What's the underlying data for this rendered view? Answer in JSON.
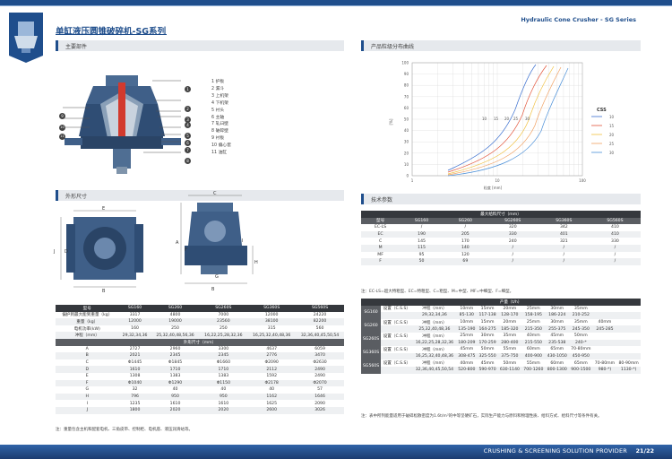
{
  "header": {
    "title_cn": "单缸液压圆锥破碎机-SG系列",
    "title_en": "Hydraulic Cone Crusher - SG Series"
  },
  "sections": {
    "main_parts": "主要部件",
    "size_dist": "产品粒级分布曲线",
    "dimensions": "外形尺寸",
    "tech": "技术参数"
  },
  "parts": [
    "1  护板",
    "2  漏斗",
    "3  上机架",
    "4  下机架",
    "5  衬头",
    "6  主轴",
    "7  轧臼壁",
    "8  破碎壁",
    "9  衬板",
    "10  偏心套",
    "11  油缸"
  ],
  "callouts": [
    "1",
    "2",
    "3",
    "4",
    "5",
    "6",
    "7",
    "8",
    "9",
    "10",
    "11"
  ],
  "dims_labels": {
    "B": "B",
    "E": "E",
    "C": "C",
    "D": "D",
    "J": "J",
    "A": "A",
    "F": "F",
    "I": "I",
    "G": "G",
    "H": "H",
    "Bb": "B"
  },
  "chart_data": {
    "type": "line",
    "xlabel": "粒度 [mm]",
    "ylabel": "[%]",
    "x_ticks": [
      "1",
      "10",
      "100"
    ],
    "y_ticks": [
      "100",
      "90",
      "80",
      "70",
      "60",
      "50",
      "40",
      "30",
      "20",
      "10",
      "0"
    ],
    "legend_title": "CSS",
    "series": [
      {
        "name": "10",
        "color": "#3a6fcf"
      },
      {
        "name": "15",
        "color": "#e2543a"
      },
      {
        "name": "20",
        "color": "#f0c040"
      },
      {
        "name": "25",
        "color": "#f0a060"
      },
      {
        "name": "30",
        "color": "#4a8fd8"
      }
    ],
    "labels": [
      "10",
      "15",
      "20",
      "25",
      "30"
    ]
  },
  "left_table": {
    "header": [
      "型号",
      "SG160",
      "SG260",
      "SG260S",
      "SG360S",
      "SG560S"
    ],
    "rows": [
      [
        "偏护到最大能到重量（kg）",
        "3317",
        "4800",
        "7000",
        "12000",
        "24220"
      ],
      [
        "重量（kg）",
        "12000",
        "19000",
        "23560",
        "38100",
        "82200"
      ],
      [
        "电机功率(kW)",
        "160",
        "250",
        "250",
        "315",
        "560"
      ],
      [
        "冲程（mm）",
        "29,32,34,36",
        "25,32,40,48,56,36",
        "16,22,25,28,32,36",
        "16,25,32,40,48,36",
        "32,36,40,45,50,54"
      ]
    ],
    "sub": "外形尺寸（mm）",
    "dims": [
      [
        "A",
        "2727",
        "2960",
        "3300",
        "4637",
        "6059"
      ],
      [
        "B",
        "2021",
        "2345",
        "2345",
        "2776",
        "3470"
      ],
      [
        "C",
        "Φ1445",
        "Φ1845",
        "Φ1660",
        "Φ2090",
        "Φ2630"
      ],
      [
        "D",
        "1610",
        "1710",
        "1710",
        "2112",
        "2490"
      ],
      [
        "E",
        "1308",
        "1383",
        "1383",
        "1592",
        "2490"
      ],
      [
        "F",
        "Φ1040",
        "Φ1290",
        "Φ1150",
        "Φ2178",
        "Φ2070"
      ],
      [
        "G",
        "32",
        "40",
        "40",
        "40",
        "57"
      ],
      [
        "H",
        "796",
        "950",
        "950",
        "1162",
        "1646"
      ],
      [
        "I",
        "1235",
        "1610",
        "1610",
        "1625",
        "2090"
      ],
      [
        "J",
        "1800",
        "2020",
        "2020",
        "2600",
        "3026"
      ]
    ],
    "note": "注：重量包含主机和配套电机、三角皮带、控制柜、电机座、液压润滑站等。"
  },
  "feed_table": {
    "title": "最大给料尺寸（mm）",
    "header": [
      "型号",
      "SG160",
      "SG260",
      "SG260S",
      "SG360S",
      "SG560S"
    ],
    "rows": [
      [
        "EC-LS",
        "/",
        "/",
        "320",
        "342",
        "410"
      ],
      [
        "EC",
        "190",
        "205",
        "330",
        "401",
        "410"
      ],
      [
        "C",
        "145",
        "170",
        "240",
        "321",
        "330"
      ],
      [
        "M",
        "115",
        "140",
        "/",
        "/",
        "/"
      ],
      [
        "MF",
        "95",
        "120",
        "/",
        "/",
        "/"
      ],
      [
        "F",
        "50",
        "69",
        "/",
        "/",
        "/"
      ]
    ],
    "note": "注：EC-LS=超大特粗型、EC=特粗型、C=粗型、M=中型、MF=中细型、F=细型。"
  },
  "capacity": {
    "title": "产量（t/h）",
    "groups": [
      {
        "model": "SG160",
        "rows": [
          [
            "设置（C.S.S）",
            "冲程（mm）",
            "10mm",
            "15mm",
            "20mm",
            "25mm",
            "30mm",
            "35mm",
            "",
            ""
          ],
          [
            "",
            "29,32,34,36",
            "85-130",
            "117-138",
            "128-170",
            "158-195",
            "186-224",
            "210-252",
            "",
            ""
          ]
        ]
      },
      {
        "model": "SG260",
        "rows": [
          [
            "设置（C.S.S）",
            "冲程（mm）",
            "10mm",
            "15mm",
            "20mm",
            "25mm",
            "30mm",
            "35mm",
            "40mm",
            ""
          ],
          [
            "",
            "25,32,40,48,36",
            "135-190",
            "164-275",
            "185-320",
            "215-350",
            "255-375",
            "245-350",
            "245-285",
            ""
          ]
        ]
      },
      {
        "model": "SG260S",
        "rows": [
          [
            "设置（C.S.S）",
            "冲程（mm）",
            "25mm",
            "30mm",
            "35mm",
            "40mm",
            "45mm",
            "50mm",
            "",
            ""
          ],
          [
            "",
            "16,22,25,28,32,36",
            "180-209",
            "170-259",
            "280-400",
            "215-550",
            "235-538",
            "240-*",
            "",
            ""
          ]
        ]
      },
      {
        "model": "SG360S",
        "rows": [
          [
            "设置（C.S.S）",
            "冲程（mm）",
            "45mm",
            "50mm",
            "55mm",
            "60mm",
            "65mm",
            "70-80mm",
            "",
            ""
          ],
          [
            "",
            "16,25,32,40,48,36",
            "308-475",
            "325-550",
            "375-750",
            "400-900",
            "430-1050",
            "450-950",
            "",
            ""
          ]
        ]
      },
      {
        "model": "SG560S",
        "rows": [
          [
            "设置（C.S.S）",
            "冲程（mm）",
            "40mm",
            "45mm",
            "50mm",
            "55mm",
            "60mm",
            "65mm",
            "70-80mm",
            "80-90mm"
          ],
          [
            "",
            "32,36,40,45,50,54",
            "520-800",
            "590-970",
            "630-1140",
            "700-1260",
            "800-1300",
            "900-1500",
            "980-*)",
            "1130-*)"
          ]
        ]
      }
    ],
    "note": "注：表中所列能量适用于破碎松散密度为1.6t/m³的中等坚硬矿石，实际生产能力与原料和物理性质、给料方式、给料尺寸等条件有关。"
  },
  "footer": {
    "text": "CRUSHING & SCREENING SOLUTION PROVIDER",
    "page": "21/22"
  }
}
